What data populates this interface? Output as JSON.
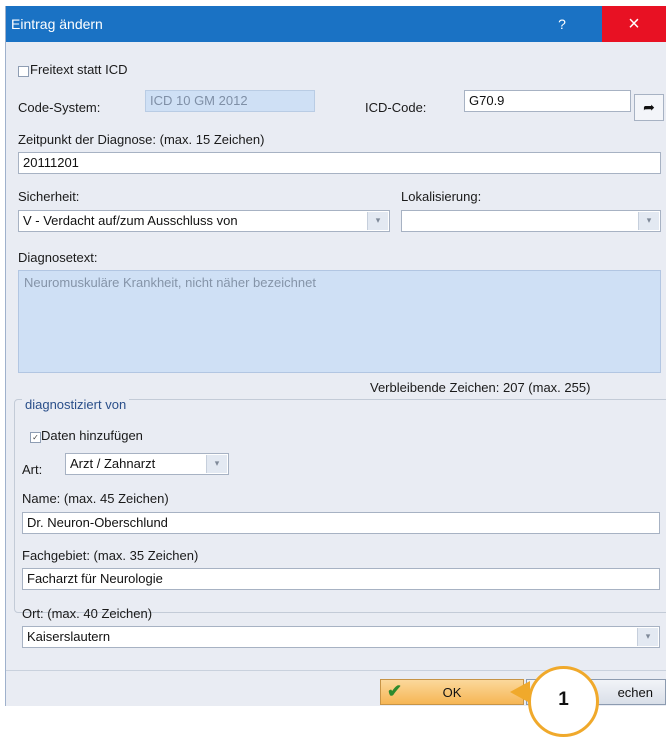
{
  "window": {
    "title": "Eintrag ändern",
    "help": "?",
    "close": "×"
  },
  "freitext": {
    "label": "Freitext statt ICD",
    "checked": false
  },
  "code_system": {
    "label": "Code-System:",
    "value": "ICD 10 GM 2012"
  },
  "icd_code": {
    "label": "ICD-Code:",
    "value": "G70.9",
    "arrow": "➦"
  },
  "zeitpunkt": {
    "label": "Zeitpunkt der Diagnose: (max. 15 Zeichen)",
    "value": "20111201"
  },
  "sicherheit": {
    "label": "Sicherheit:",
    "value": "V - Verdacht auf/zum Ausschluss von"
  },
  "lokalisierung": {
    "label": "Lokalisierung:",
    "value": ""
  },
  "diagnosetext": {
    "label": "Diagnosetext:",
    "value": "Neuromuskuläre Krankheit, nicht näher bezeichnet"
  },
  "remaining": "Verbleibende Zeichen: 207 (max. 255)",
  "diagnostiziert": {
    "group_label": "diagnostiziert von",
    "daten": {
      "label": "Daten hinzufügen",
      "checked": true
    },
    "art": {
      "label": "Art:",
      "value": "Arzt / Zahnarzt"
    },
    "name": {
      "label": "Name: (max. 45 Zeichen)",
      "value": "Dr. Neuron-Oberschlund"
    },
    "fachgebiet": {
      "label": "Fachgebiet: (max. 35 Zeichen)",
      "value": "Facharzt für Neurologie"
    },
    "ort": {
      "label": "Ort: (max. 40 Zeichen)",
      "value": "Kaiserslautern"
    }
  },
  "buttons": {
    "ok": "OK",
    "cancel": "echen"
  },
  "callout": "1",
  "colors": {
    "titlebar": "#1a72c4",
    "close": "#e81123",
    "ok": "#f6b655",
    "callout": "#f0a92b"
  }
}
